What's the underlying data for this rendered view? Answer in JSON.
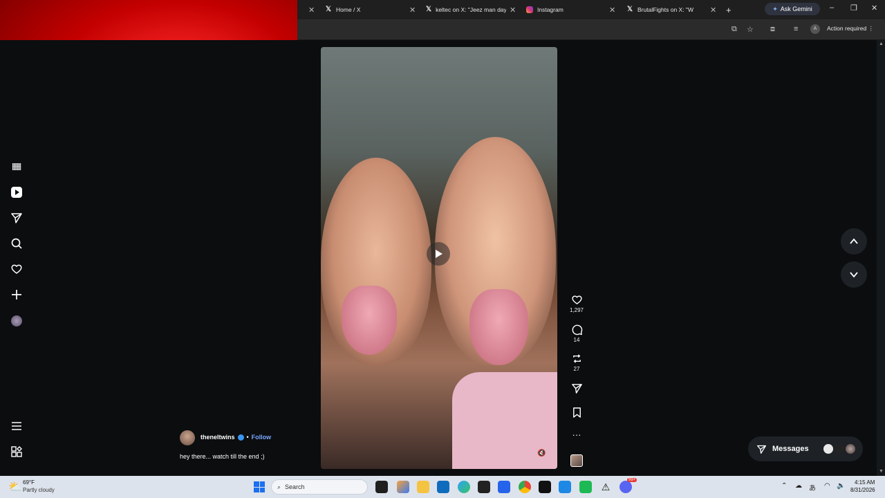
{
  "browser": {
    "tabs": [
      {
        "label": "Home / X",
        "icon": "x-logo-icon"
      },
      {
        "label": "keltec on X: \"Jeez man days",
        "icon": "x-logo-icon"
      },
      {
        "label": "Instagram",
        "icon": "instagram-icon"
      },
      {
        "label": "BrutalFights on X: \"W",
        "icon": "x-logo-icon"
      }
    ],
    "ask_gemini": "Ask Gemini",
    "action_required": "Action required",
    "profile_initial": "A"
  },
  "reel": {
    "author": "theneltwins",
    "separator": "•",
    "follow_label": "Follow",
    "caption": "hey there... watch till the end ;)",
    "likes": "1,297",
    "comments": "14",
    "reposts": "27"
  },
  "messages_label": "Messages",
  "taskbar": {
    "temperature": "69°F",
    "condition": "Partly cloudy",
    "search_placeholder": "Search",
    "time": "4:15 AM",
    "date": "8/31/2026",
    "notification_badge": "99+"
  },
  "colors": {
    "background": "#0b0d0f",
    "accent_blue": "#3897f0",
    "follow_link": "#7aa7ff",
    "webcam_red": "#c40000"
  }
}
